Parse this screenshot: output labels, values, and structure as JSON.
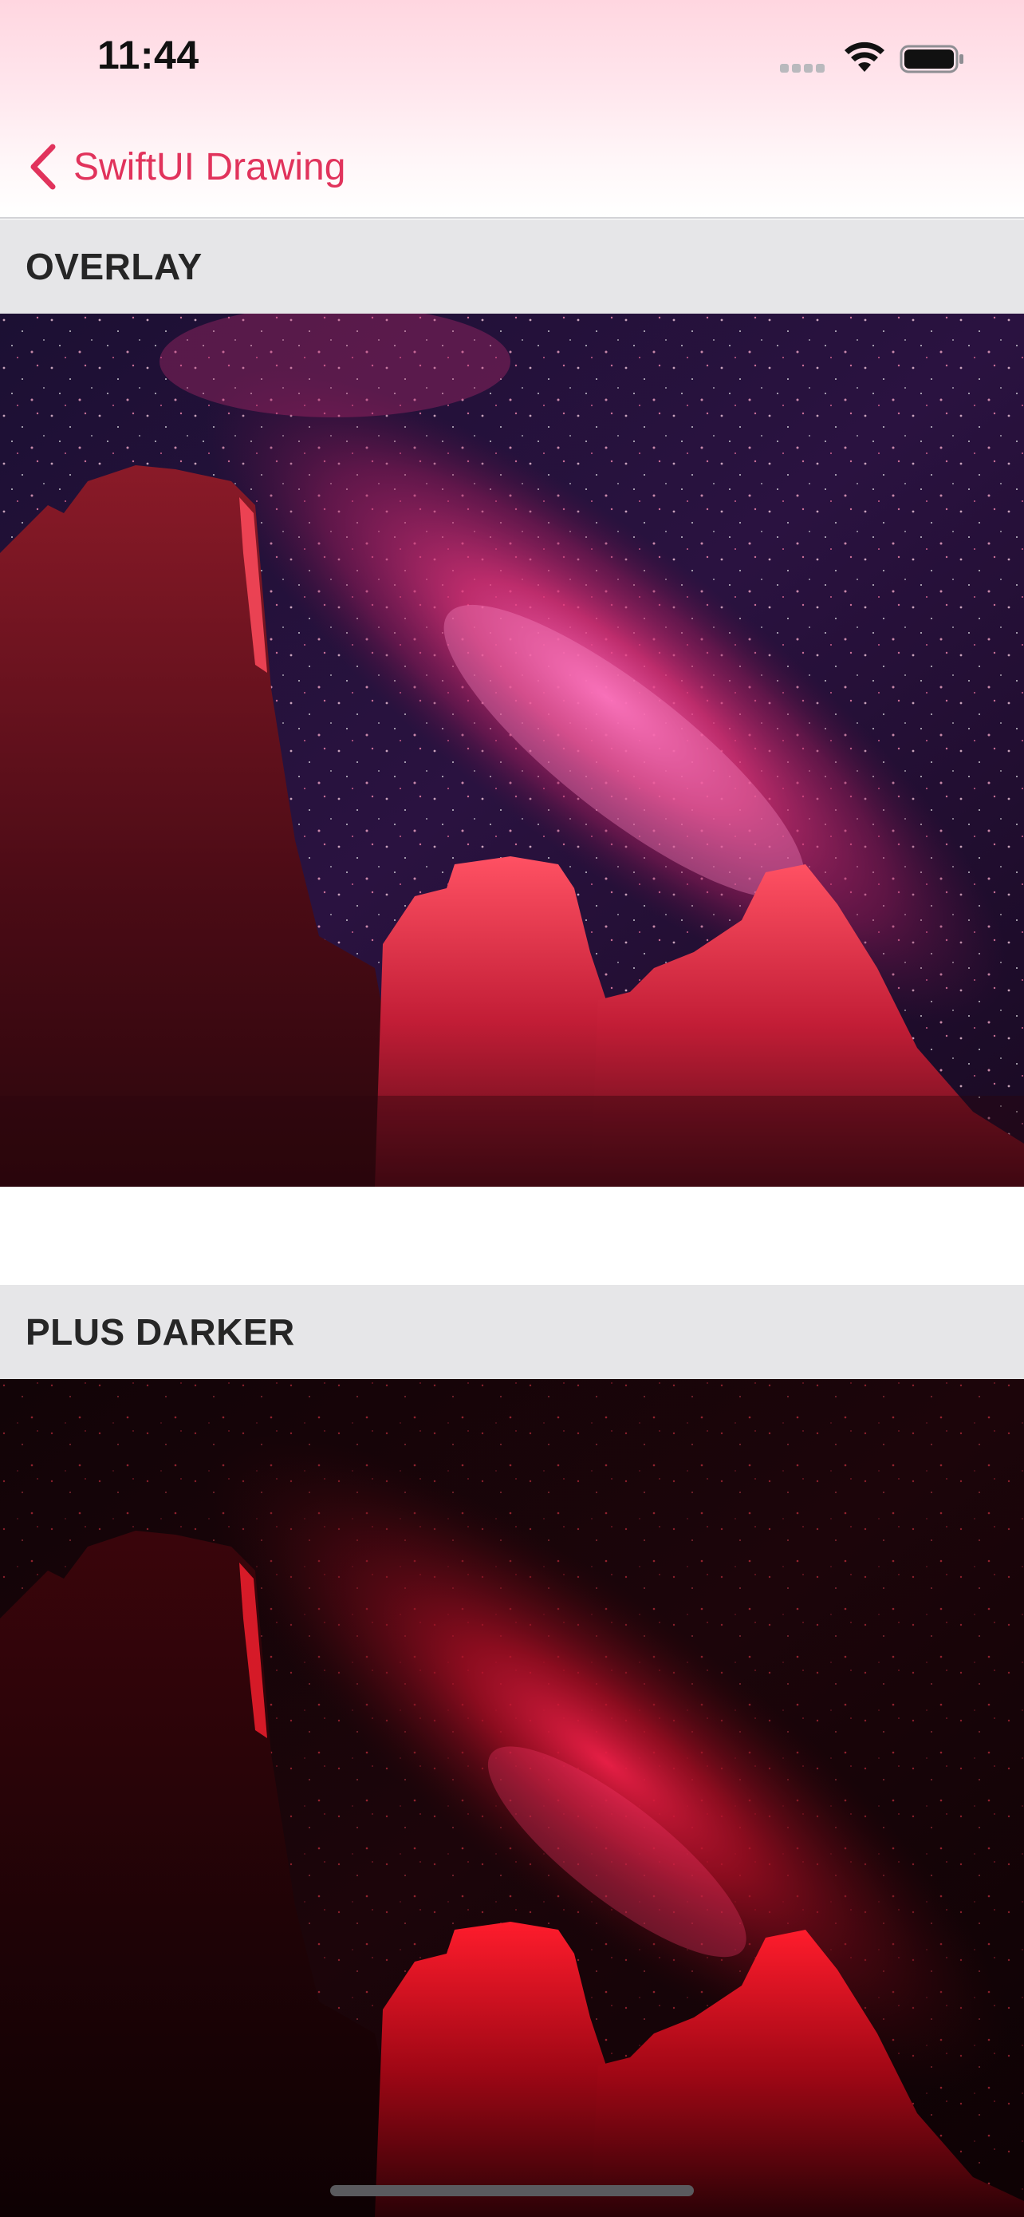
{
  "status_bar": {
    "time": "11:44",
    "signal_icon": "cellular-signal-icon",
    "wifi_icon": "wifi-icon",
    "battery_icon": "battery-icon"
  },
  "nav": {
    "back_icon": "chevron-left-icon",
    "back_label": "SwiftUI Drawing"
  },
  "sections": [
    {
      "title": "OVERLAY",
      "image": "Desert rock spires under a starry night sky with the Milky Way, rendered with overlay blend mode (pink/red tint)"
    },
    {
      "title": "PLUS DARKER",
      "image": "Desert rock spires under a starry night sky with the Milky Way, rendered with plus-darker blend mode (deep red, darkened)"
    }
  ],
  "colors": {
    "accent": "#e1335c",
    "section_header_bg": "#e6e6e8",
    "section_header_text": "#262626"
  }
}
